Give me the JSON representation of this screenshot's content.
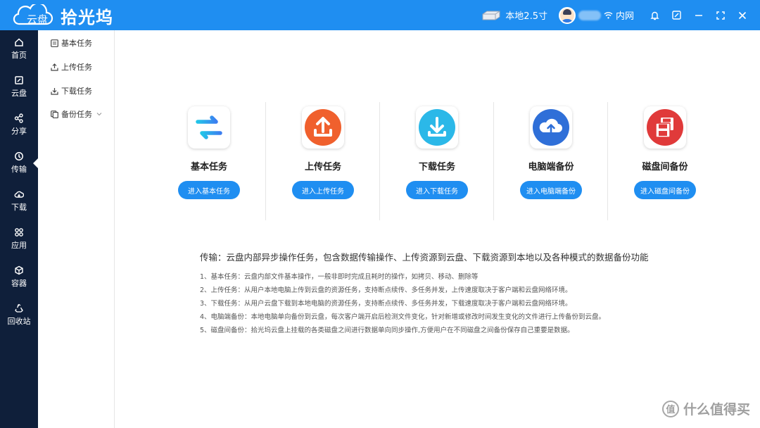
{
  "app": {
    "logo_cloud_text": "云盘",
    "logo_text": "拾光坞"
  },
  "titlebar": {
    "drive_label": "本地2.5寸",
    "network_label": "内网"
  },
  "nav": {
    "items": [
      {
        "label": "首页",
        "icon": "home-icon"
      },
      {
        "label": "云盘",
        "icon": "cloud-disk-icon"
      },
      {
        "label": "分享",
        "icon": "share-icon"
      },
      {
        "label": "传输",
        "icon": "transfer-icon",
        "active": true
      },
      {
        "label": "下载",
        "icon": "download-cloud-icon"
      },
      {
        "label": "应用",
        "icon": "apps-icon"
      },
      {
        "label": "容器",
        "icon": "container-icon"
      },
      {
        "label": "回收站",
        "icon": "recycle-icon"
      }
    ]
  },
  "submenu": {
    "items": [
      {
        "label": "基本任务"
      },
      {
        "label": "上传任务"
      },
      {
        "label": "下载任务"
      },
      {
        "label": "备份任务"
      }
    ]
  },
  "cards": [
    {
      "title": "基本任务",
      "button": "进入基本任务",
      "icon": "swap-arrows-icon",
      "color": "#1fb6e8"
    },
    {
      "title": "上传任务",
      "button": "进入上传任务",
      "icon": "upload-icon",
      "color": "#f0602d"
    },
    {
      "title": "下载任务",
      "button": "进入下载任务",
      "icon": "download-icon",
      "color": "#2bb8e8"
    },
    {
      "title": "电脑端备份",
      "button": "进入电脑端备份",
      "icon": "cloud-upload-icon",
      "color": "#2f6fd8"
    },
    {
      "title": "磁盘间备份",
      "button": "进入磁盘间备份",
      "icon": "floppy-icon",
      "color": "#e03a3a"
    }
  ],
  "description": {
    "heading": "传输：云盘内部异步操作任务，包含数据传输操作、上传资源到云盘、下载资源到本地以及各种模式的数据备份功能",
    "lines": [
      "1、基本任务：云盘内部文件基本操作，一般非即时完成且耗时的操作，如拷贝、移动、删除等",
      "2、上传任务：从用户本地电脑上传到云盘的资源任务，支持断点续传、多任务并发，上传速度取决于客户端和云盘网络环境。",
      "3、下载任务：从用户云盘下载到本地电脑的资源任务，支持断点续传、多任务并发，下载速度取决于客户端和云盘网络环境。",
      "4、电脑端备份：本地电脑单向备份到云盘，每次客户端开启后检测文件变化，针对新增或修改时间发生变化的文件进行上传备份到云盘。",
      "5、磁盘间备份：拾光坞云盘上挂载的各类磁盘之间进行数据单向同步操作,方便用户在不同磁盘之间备份保存自己重要是数据。"
    ]
  },
  "watermark": {
    "icon_text": "值",
    "text": "什么值得买"
  }
}
